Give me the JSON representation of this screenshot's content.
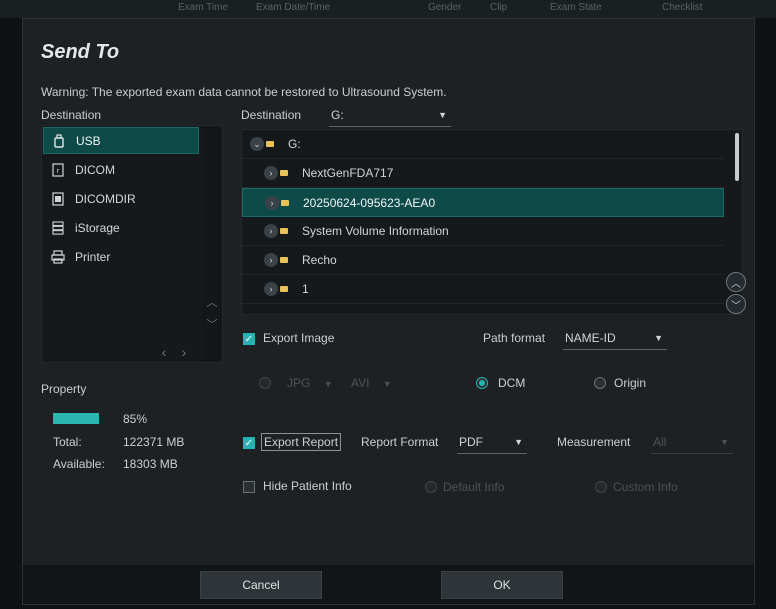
{
  "background_header": [
    "Exam Time",
    "Exam Date/Time",
    "Gender",
    "Clip",
    "Exam State",
    "Checklist"
  ],
  "dialog": {
    "title": "Send To",
    "warning": "Warning: The exported exam data cannot be restored to Ultrasound System."
  },
  "destination_panel": {
    "label": "Destination",
    "items": [
      {
        "label": "USB",
        "icon": "usb-icon",
        "selected": true
      },
      {
        "label": "DICOM",
        "icon": "dicom-icon",
        "selected": false
      },
      {
        "label": "DICOMDIR",
        "icon": "dicomdir-icon",
        "selected": false
      },
      {
        "label": "iStorage",
        "icon": "storage-icon",
        "selected": false
      },
      {
        "label": "Printer",
        "icon": "printer-icon",
        "selected": false
      }
    ]
  },
  "tree_panel": {
    "label": "Destination",
    "drive_select": "G:",
    "rows": [
      {
        "label": "G:",
        "level": 0,
        "expanded": true,
        "selected": false
      },
      {
        "label": "NextGenFDA717",
        "level": 1,
        "selected": false
      },
      {
        "label": "20250624-095623-AEA0",
        "level": 1,
        "selected": true
      },
      {
        "label": "System Volume Information",
        "level": 1,
        "selected": false
      },
      {
        "label": "Recho",
        "level": 1,
        "selected": false
      },
      {
        "label": "1",
        "level": 1,
        "selected": false
      }
    ]
  },
  "export_image": {
    "label": "Export Image",
    "checked": true,
    "path_format_label": "Path format",
    "path_format_value": "NAME-ID",
    "jpg_label": "JPG",
    "avi_label": "AVI",
    "dcm_label": "DCM",
    "origin_label": "Origin",
    "selected_format": "DCM"
  },
  "property": {
    "label": "Property",
    "usage_percent_text": "85%",
    "usage_fraction": 0.85,
    "total_label": "Total:",
    "total_value": "122371 MB",
    "available_label": "Available:",
    "available_value": "18303 MB"
  },
  "export_report": {
    "label": "Export Report",
    "checked": true,
    "report_format_label": "Report Format",
    "report_format_value": "PDF",
    "measurement_label": "Measurement",
    "measurement_value": "All"
  },
  "hide_patient": {
    "label": "Hide Patient Info",
    "checked": false,
    "default_info_label": "Default Info",
    "custom_info_label": "Custom Info"
  },
  "footer": {
    "cancel_label": "Cancel",
    "ok_label": "OK"
  },
  "colors": {
    "accent": "#26b4b0",
    "selection": "#0e4a47",
    "folder": "#e8c35a"
  }
}
